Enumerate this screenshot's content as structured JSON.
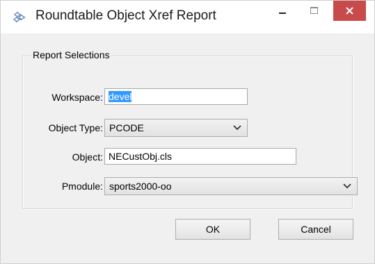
{
  "window": {
    "title": "Roundtable Object Xref Report"
  },
  "group": {
    "legend": "Report Selections"
  },
  "form": {
    "workspace_label": "Workspace:",
    "workspace_value": "devel",
    "object_type_label": "Object Type:",
    "object_type_value": "PCODE",
    "object_label": "Object:",
    "object_value": "NECustObj.cls",
    "pmodule_label": "Pmodule:",
    "pmodule_value": "sports2000-oo"
  },
  "buttons": {
    "ok_label": "OK",
    "cancel_label": "Cancel"
  },
  "colors": {
    "close_button": "#c94a4a",
    "selection": "#3399ff"
  },
  "icons": {
    "app": "roundtable-app-icon",
    "minimize": "minimize-icon",
    "maximize": "maximize-icon",
    "close": "close-icon",
    "dropdown": "chevron-down-icon"
  }
}
